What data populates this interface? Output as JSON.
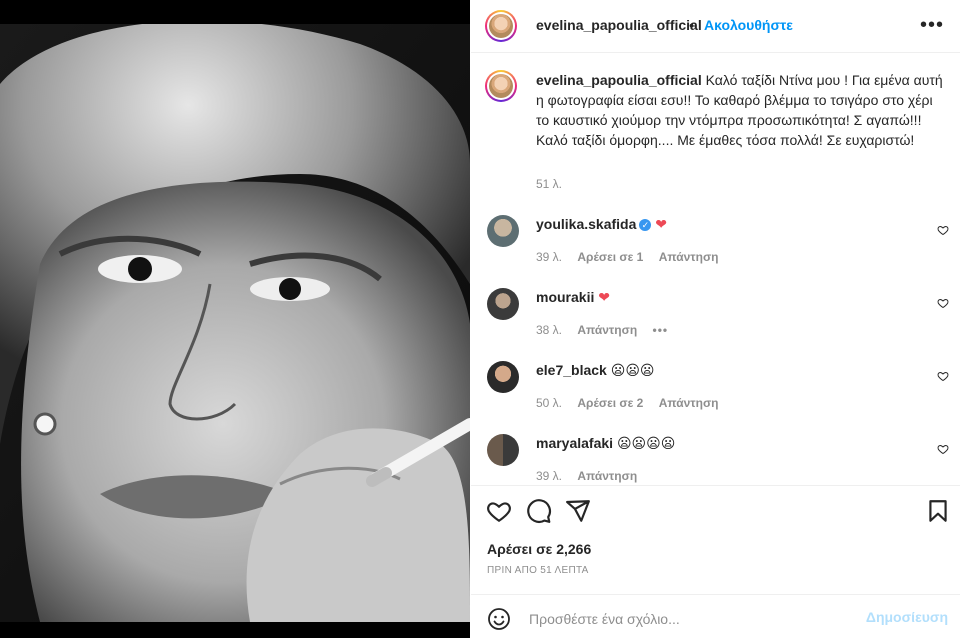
{
  "post": {
    "username": "evelina_papoulia_official",
    "separator": "•",
    "follow_label": "Ακολουθήστε",
    "more_label": "•••",
    "caption_text": "Καλό ταξίδι Ντίνα μου ! Για εμένα αυτή η φωτογραφία είσαι εσυ!! Το καθαρό βλέμμα το τσιγάρο στο χέρι το καυστικό χιούμορ την ντόμπρα προσωπικότητα! Σ αγαπώ!!! Καλό ταξίδι όμορφη.... Με έμαθες τόσα πολλά! Σε ευχαριστώ!",
    "caption_time": "51 λ."
  },
  "comments": [
    {
      "user": "youlika.skafida",
      "verified": true,
      "text": "❤",
      "time": "39 λ.",
      "likes": "Αρέσει σε 1",
      "reply": "Απάντηση"
    },
    {
      "user": "mourakii",
      "verified": false,
      "text": "❤",
      "time": "38 λ.",
      "likes": "",
      "reply": "Απάντηση",
      "more": "•••"
    },
    {
      "user": "ele7_black",
      "verified": false,
      "text": "😦😦😦",
      "time": "50 λ.",
      "likes": "Αρέσει σε 2",
      "reply": "Απάντηση"
    },
    {
      "user": "maryalafaki",
      "verified": false,
      "text": "😦😦😦😦",
      "time": "39 λ.",
      "likes": "",
      "reply": "Απάντηση"
    }
  ],
  "footer": {
    "likes_text": "Αρέσει σε 2,266",
    "posted_ago": "ΠΡΙΝ ΑΠΟ 51 ΛΕΠΤΑ",
    "comment_placeholder": "Προσθέστε ένα σχόλιο...",
    "post_button": "Δημοσίευση"
  },
  "icons": [
    "heart-icon",
    "comment-icon",
    "share-icon",
    "bookmark-icon",
    "emoji-icon",
    "more-icon",
    "verified-icon"
  ],
  "colors": {
    "link": "#0095f6",
    "muted": "#8e8e8e",
    "heart": "#ed4956",
    "post_disabled": "#b2dffc"
  }
}
